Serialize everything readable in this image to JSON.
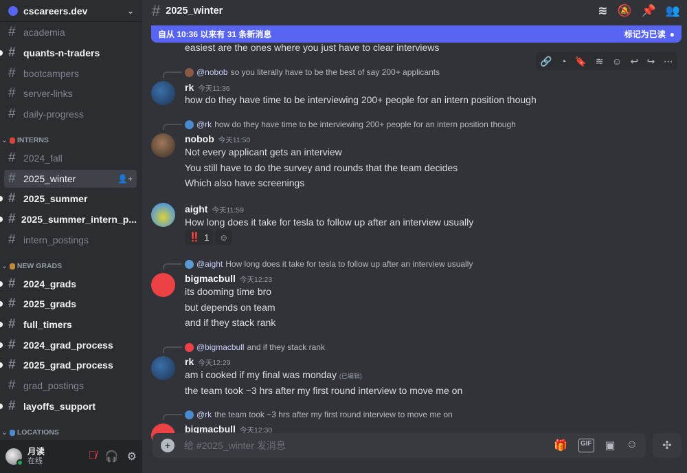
{
  "server": {
    "name": "cscareers.dev"
  },
  "channels": [
    {
      "name": "academia",
      "unread": false
    },
    {
      "name": "quants-n-traders",
      "unread": true
    },
    {
      "name": "bootcampers",
      "unread": false
    },
    {
      "name": "server-links",
      "unread": false
    },
    {
      "name": "daily-progress",
      "unread": false
    }
  ],
  "categories": {
    "interns": "INTERNS",
    "new_grads": "NEW GRADS",
    "locations": "LOCATIONS"
  },
  "interns": [
    {
      "name": "2024_fall",
      "unread": false
    },
    {
      "name": "2025_winter",
      "unread": false,
      "selected": true
    },
    {
      "name": "2025_summer",
      "unread": true
    },
    {
      "name": "2025_summer_intern_p...",
      "unread": true
    },
    {
      "name": "intern_postings",
      "unread": false
    }
  ],
  "new_grads": [
    {
      "name": "2024_grads",
      "unread": true
    },
    {
      "name": "2025_grads",
      "unread": true
    },
    {
      "name": "full_timers",
      "unread": true
    },
    {
      "name": "2024_grad_process",
      "unread": true
    },
    {
      "name": "2025_grad_process",
      "unread": true
    },
    {
      "name": "grad_postings",
      "unread": false
    },
    {
      "name": "layoffs_support",
      "unread": true
    }
  ],
  "user": {
    "name": "月读",
    "status": "在线"
  },
  "header": {
    "channel": "2025_winter"
  },
  "banner": {
    "text": "自从 10:36 以来有 31 条新消息",
    "mark_read": "标记为已读"
  },
  "messages": {
    "m0": "easiest are the ones where you just have to clear interviews",
    "r1": {
      "mention": "@nobob",
      "text": "so you literally have to be the best of say 200+ applicants"
    },
    "u1": {
      "name": "rk",
      "time": "今天11:36",
      "lines": [
        "how do they have time to be interviewing 200+ people for an intern position though"
      ]
    },
    "r2": {
      "mention": "@rk",
      "text": "how do they have time to be interviewing 200+ people for an intern position though"
    },
    "u2": {
      "name": "nobob",
      "time": "今天11:50",
      "lines": [
        "Not every applicant gets an interview",
        "You still have to do the survey and rounds that the team decides",
        "Which also have screenings"
      ]
    },
    "u3": {
      "name": "aight",
      "time": "今天11:59",
      "lines": [
        "How long does it take for tesla to follow up after an interview usually"
      ],
      "reaction": {
        "emoji": "‼️",
        "count": "1"
      }
    },
    "r4": {
      "mention": "@aight",
      "text": "How long does it take for tesla to follow up after an interview usually"
    },
    "u4": {
      "name": "bigmacbull",
      "time": "今天12:23",
      "lines": [
        "its dooming time bro",
        "but depends on team",
        "and if they stack rank"
      ]
    },
    "r5": {
      "mention": "@bigmacbull",
      "text": "and if they stack rank"
    },
    "u5": {
      "name": "rk",
      "time": "今天12:29",
      "lines": [
        "am i cooked if my final was monday",
        "the team took ~3 hrs after my first round interview to move me on"
      ],
      "edited": "(已编辑)"
    },
    "r6": {
      "mention": "@rk",
      "text": "the team took ~3 hrs after my first round interview to move me on"
    },
    "u6": {
      "name": "bigmacbull",
      "time": "今天12:30"
    }
  },
  "composer": {
    "placeholder": "给 #2025_winter 发消息"
  },
  "colors": {
    "accent": "#5865f2",
    "sidebar": "#2b2d31",
    "main": "#313338",
    "online": "#23a55a",
    "discord_red": "#ed4245"
  }
}
